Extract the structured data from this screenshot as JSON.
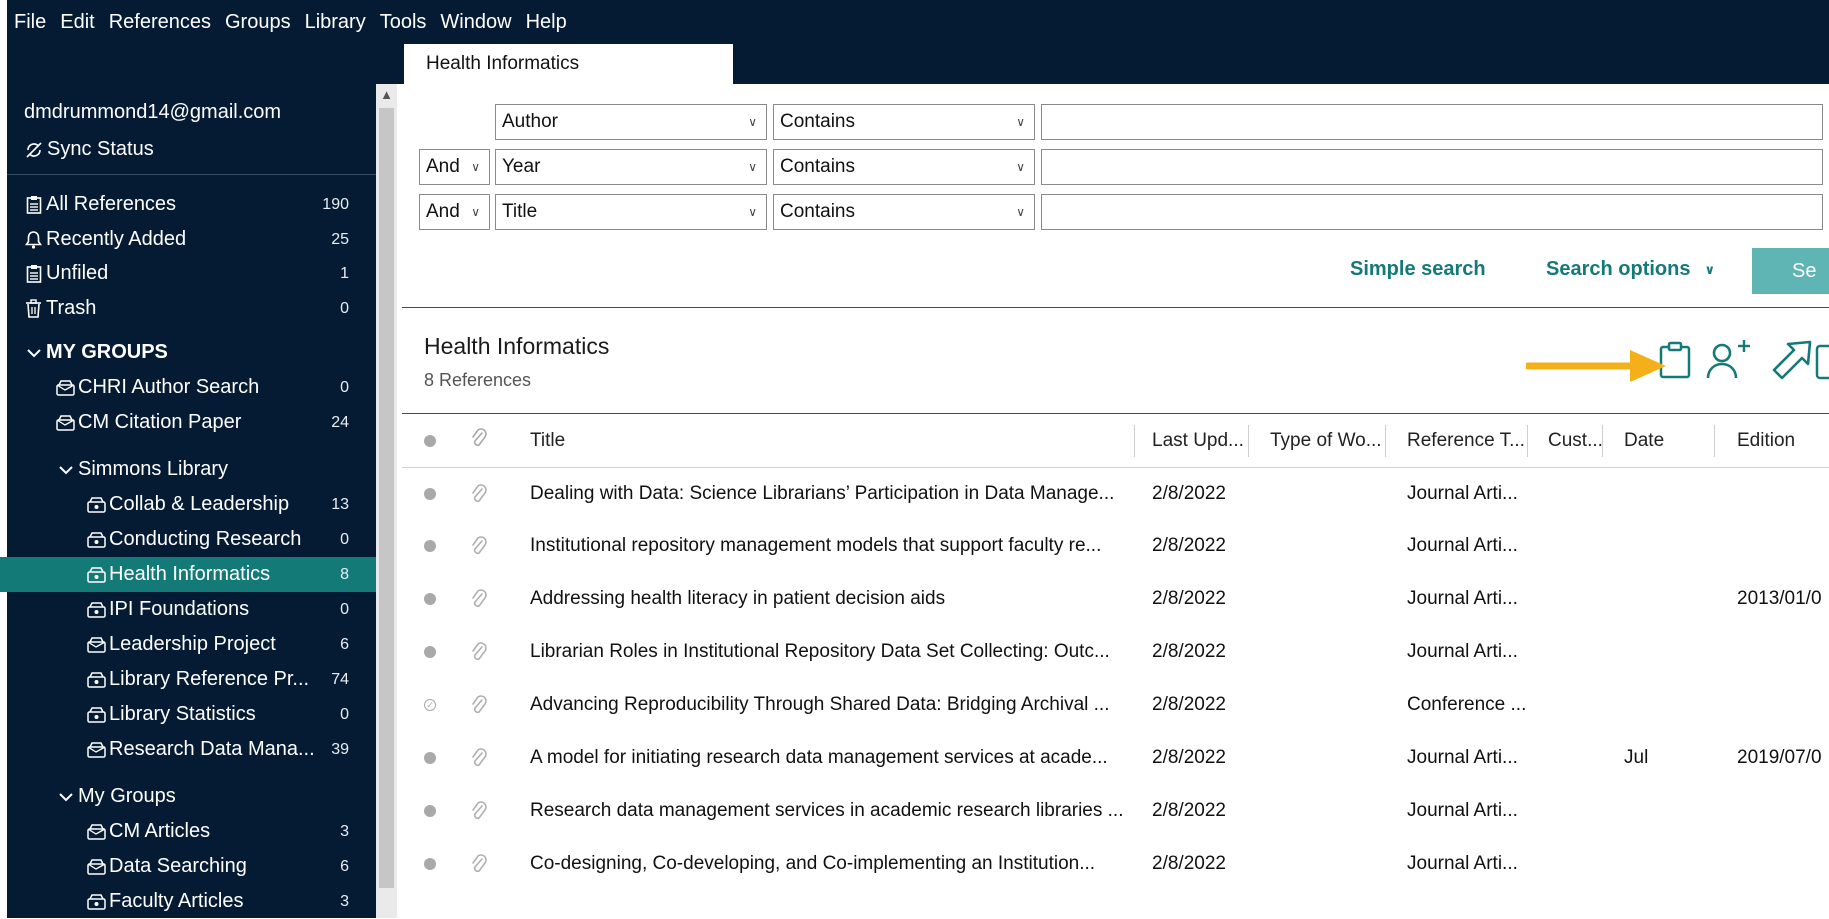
{
  "menu": [
    "File",
    "Edit",
    "References",
    "Groups",
    "Library",
    "Tools",
    "Window",
    "Help"
  ],
  "tab": {
    "label": "Health Informatics"
  },
  "sidebar": {
    "account": "dmdrummond14@gmail.com",
    "sync_status": "Sync Status",
    "library": [
      {
        "label": "All References",
        "count": "190",
        "icon": "clipboard-icon"
      },
      {
        "label": "Recently Added",
        "count": "25",
        "icon": "bell-icon"
      },
      {
        "label": "Unfiled",
        "count": "1",
        "icon": "clipboard-icon"
      },
      {
        "label": "Trash",
        "count": "0",
        "icon": "trash-icon"
      }
    ],
    "my_groups_header": "MY GROUPS",
    "groups": [
      {
        "label": "CHRI Author Search",
        "count": "0"
      },
      {
        "label": "CM Citation Paper",
        "count": "24"
      }
    ],
    "simmons_header": "Simmons Library",
    "simmons": [
      {
        "label": "Collab & Leadership",
        "count": "13"
      },
      {
        "label": "Conducting Research",
        "count": "0"
      },
      {
        "label": "Health Informatics",
        "count": "8",
        "active": true
      },
      {
        "label": "IPI Foundations",
        "count": "0"
      },
      {
        "label": "Leadership Project",
        "count": "6"
      },
      {
        "label": "Library Reference Pr...",
        "count": "74"
      },
      {
        "label": "Library Statistics",
        "count": "0"
      },
      {
        "label": "Research Data Mana...",
        "count": "39"
      }
    ],
    "my_groups2_header": "My Groups",
    "my_groups2": [
      {
        "label": "CM Articles",
        "count": "3"
      },
      {
        "label": "Data Searching",
        "count": "6"
      },
      {
        "label": "Faculty Articles",
        "count": "3"
      }
    ]
  },
  "search": {
    "rows": [
      {
        "bool": "",
        "field": "Author",
        "op": "Contains"
      },
      {
        "bool": "And",
        "field": "Year",
        "op": "Contains"
      },
      {
        "bool": "And",
        "field": "Title",
        "op": "Contains"
      }
    ],
    "simple_search": "Simple search",
    "search_options": "Search options",
    "search_button": "Se"
  },
  "results": {
    "title": "Health Informatics",
    "count_label": "8 References",
    "columns": [
      "Title",
      "Last Upd...",
      "Type of Wo...",
      "Reference T...",
      "Cust...",
      "Date",
      "Edition"
    ],
    "rows": [
      {
        "title": "Dealing with Data: Science Librarians’ Participation in Data Manage...",
        "updated": "2/8/2022",
        "type": "",
        "ref_type": "Journal Arti...",
        "custom": "",
        "date": "",
        "edition": "",
        "status": "unread"
      },
      {
        "title": "Institutional repository management models that support faculty re...",
        "updated": "2/8/2022",
        "type": "",
        "ref_type": "Journal Arti...",
        "custom": "",
        "date": "",
        "edition": "",
        "status": "unread"
      },
      {
        "title": "Addressing health literacy in patient decision aids",
        "updated": "2/8/2022",
        "type": "",
        "ref_type": "Journal Arti...",
        "custom": "",
        "date": "",
        "edition": "2013/01/0",
        "status": "unread"
      },
      {
        "title": "Librarian Roles in Institutional Repository Data Set Collecting: Outc...",
        "updated": "2/8/2022",
        "type": "",
        "ref_type": "Journal Arti...",
        "custom": "",
        "date": "",
        "edition": "",
        "status": "unread"
      },
      {
        "title": "Advancing Reproducibility Through Shared Data: Bridging Archival ...",
        "updated": "2/8/2022",
        "type": "",
        "ref_type": "Conference ...",
        "custom": "",
        "date": "",
        "edition": "",
        "status": "read"
      },
      {
        "title": "A model for initiating research data management services at acade...",
        "updated": "2/8/2022",
        "type": "",
        "ref_type": "Journal Arti...",
        "custom": "",
        "date": "Jul",
        "edition": "2019/07/0",
        "status": "unread"
      },
      {
        "title": "Research data management services in academic research libraries ...",
        "updated": "2/8/2022",
        "type": "",
        "ref_type": "Journal Arti...",
        "custom": "",
        "date": "",
        "edition": "",
        "status": "unread"
      },
      {
        "title": "Co-designing, Co-developing, and Co-implementing an Institution...",
        "updated": "2/8/2022",
        "type": "",
        "ref_type": "Journal Arti...",
        "custom": "",
        "date": "",
        "edition": "",
        "status": "unread"
      }
    ]
  },
  "colors": {
    "navy": "#051b33",
    "teal": "#147a78",
    "teal_light": "#5fb5b4",
    "annotation_arrow": "#f4b019"
  }
}
